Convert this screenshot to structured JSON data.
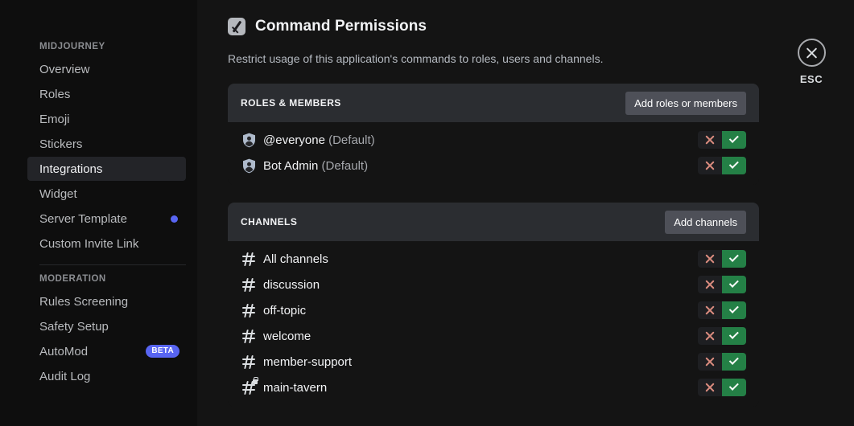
{
  "sidebar": {
    "sections": [
      {
        "heading": "MIDJOURNEY",
        "items": [
          {
            "label": "Overview",
            "active": false,
            "badge": null
          },
          {
            "label": "Roles",
            "active": false,
            "badge": null
          },
          {
            "label": "Emoji",
            "active": false,
            "badge": null
          },
          {
            "label": "Stickers",
            "active": false,
            "badge": null
          },
          {
            "label": "Integrations",
            "active": true,
            "badge": null
          },
          {
            "label": "Widget",
            "active": false,
            "badge": null
          },
          {
            "label": "Server Template",
            "active": false,
            "badge": "dot"
          },
          {
            "label": "Custom Invite Link",
            "active": false,
            "badge": null
          }
        ]
      },
      {
        "heading": "MODERATION",
        "items": [
          {
            "label": "Rules Screening",
            "active": false,
            "badge": null
          },
          {
            "label": "Safety Setup",
            "active": false,
            "badge": null
          },
          {
            "label": "AutoMod",
            "active": false,
            "badge": "BETA"
          },
          {
            "label": "Audit Log",
            "active": false,
            "badge": null
          }
        ]
      }
    ]
  },
  "header": {
    "title": "Command Permissions",
    "icon": "slash-command-icon",
    "description": "Restrict usage of this application's commands to roles, users and channels."
  },
  "close": {
    "icon": "close-icon",
    "label": "ESC"
  },
  "cards": [
    {
      "id": "roles-and-members",
      "title": "ROLES & MEMBERS",
      "add_label": "Add roles or members",
      "rows": [
        {
          "name": "@everyone",
          "suffix": " (Default)",
          "icon": "role-shield-icon",
          "permission": "allow"
        },
        {
          "name": "Bot Admin",
          "suffix": " (Default)",
          "icon": "role-shield-icon",
          "permission": "allow"
        }
      ]
    },
    {
      "id": "channels",
      "title": "CHANNELS",
      "add_label": "Add channels",
      "rows": [
        {
          "name": "All channels",
          "suffix": "",
          "icon": "hash-icon",
          "permission": "allow"
        },
        {
          "name": "discussion",
          "suffix": "",
          "icon": "hash-icon",
          "permission": "allow"
        },
        {
          "name": "off-topic",
          "suffix": "",
          "icon": "hash-icon",
          "permission": "allow"
        },
        {
          "name": "welcome",
          "suffix": "",
          "icon": "hash-icon",
          "permission": "allow"
        },
        {
          "name": "member-support",
          "suffix": "",
          "icon": "hash-icon",
          "permission": "allow"
        },
        {
          "name": "main-tavern",
          "suffix": "",
          "icon": "hash-private-icon",
          "permission": "allow"
        }
      ]
    }
  ],
  "colors": {
    "accent": "#5865f2",
    "allow": "#248046",
    "deny": "#d98b7e",
    "card_header": "#2b2d31",
    "button": "#4e5058"
  }
}
